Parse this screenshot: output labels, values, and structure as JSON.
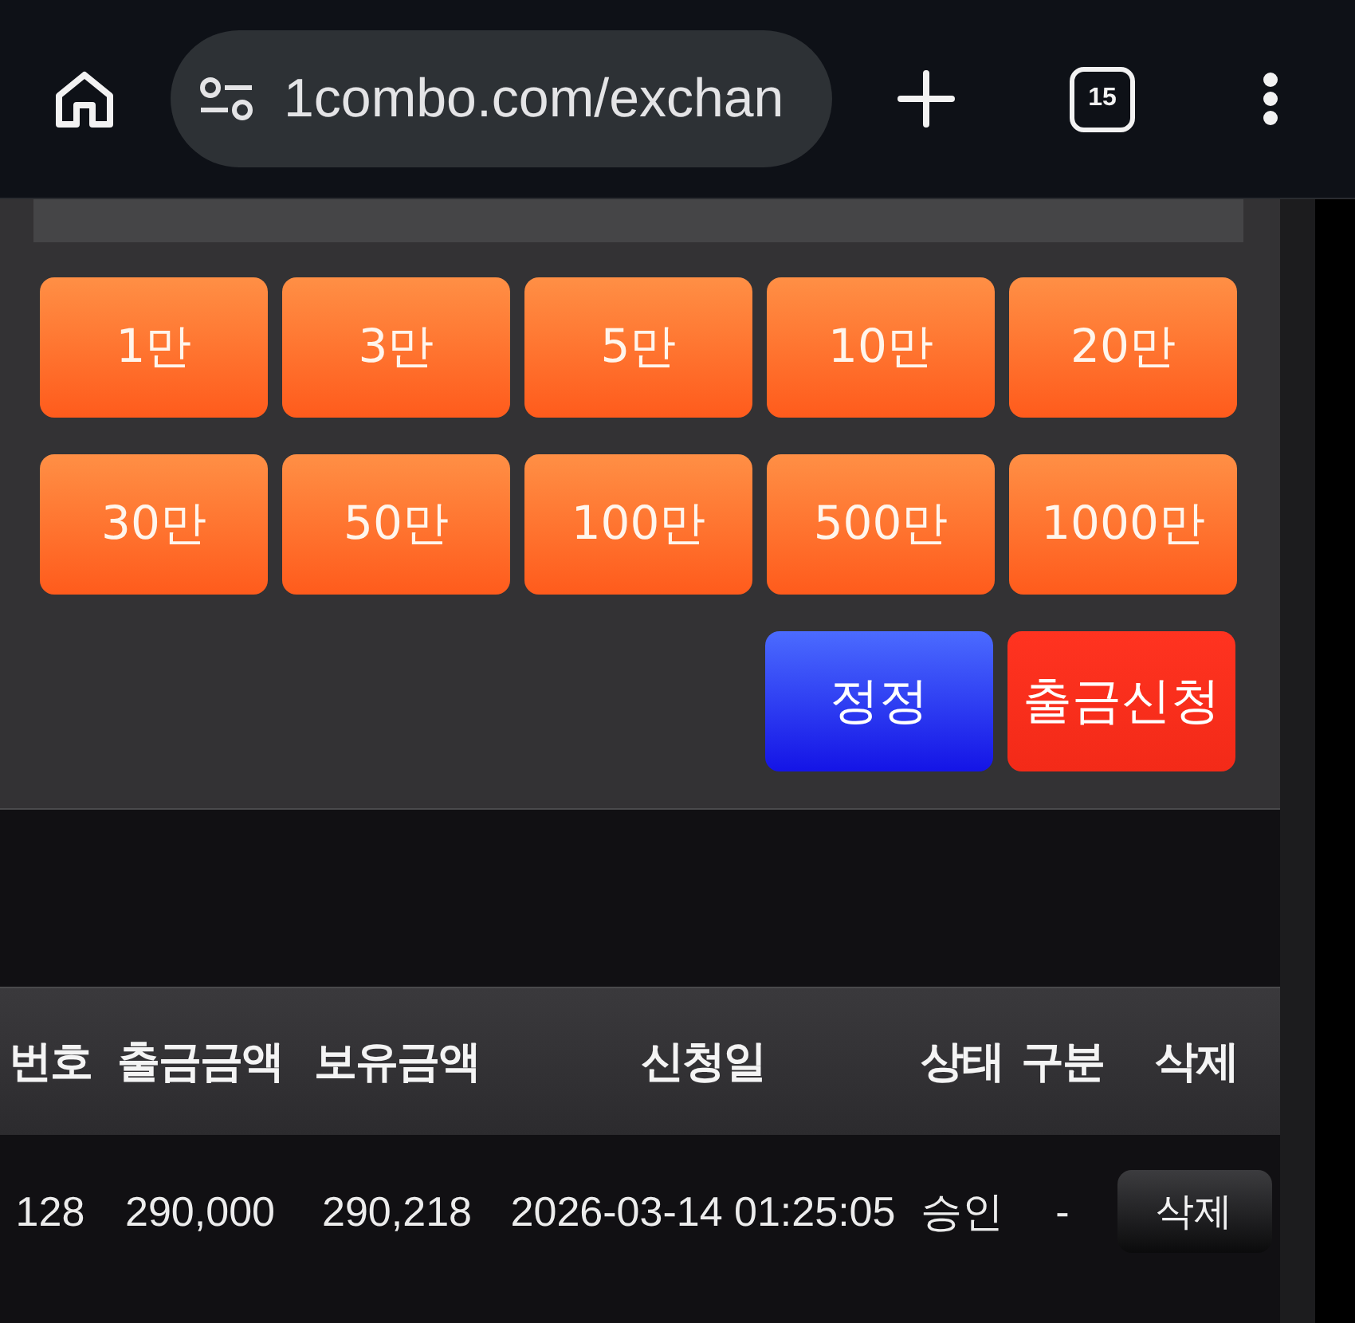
{
  "browser": {
    "url": "1combo.com/exchan",
    "tab_count": "15"
  },
  "amount_buttons": [
    "1만",
    "3만",
    "5만",
    "10만",
    "20만",
    "30만",
    "50만",
    "100만",
    "500만",
    "1000만"
  ],
  "actions": [
    {
      "label": "정정",
      "kind": "correct"
    },
    {
      "label": "출금신청",
      "kind": "request"
    }
  ],
  "table": {
    "columns": [
      "번호",
      "출금금액",
      "보유금액",
      "신청일",
      "상태",
      "구분",
      "삭제"
    ],
    "rows": [
      {
        "cells": [
          "128",
          "290,000",
          "290,218",
          "2026-03-14 01:25:05",
          "승인",
          "-"
        ],
        "delete_button": "삭제"
      }
    ]
  }
}
